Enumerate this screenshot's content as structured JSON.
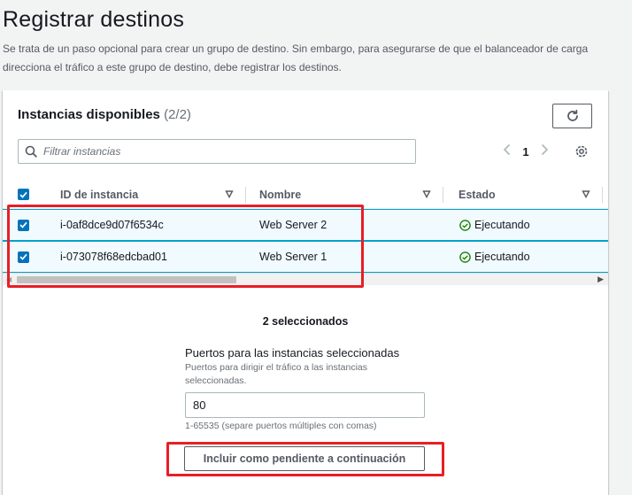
{
  "page": {
    "title": "Registrar destinos",
    "description": "Se trata de un paso opcional para crear un grupo de destino. Sin embargo, para asegurarse de que el balanceador de carga direcciona el tráfico a este grupo de destino, debe registrar los destinos."
  },
  "instances_panel": {
    "title": "Instancias disponibles",
    "count": "(2/2)",
    "filter_placeholder": "Filtrar instancias",
    "current_page": "1",
    "columns": [
      "ID de instancia",
      "Nombre",
      "Estado"
    ],
    "rows": [
      {
        "id": "i-0af8dce9d07f6534c",
        "name": "Web Server 2",
        "status": "Ejecutando",
        "selected": true
      },
      {
        "id": "i-073078f68edcbad01",
        "name": "Web Server 1",
        "status": "Ejecutando",
        "selected": true
      }
    ]
  },
  "selection": {
    "count_label": "2 seleccionados",
    "ports_label": "Puertos para las instancias seleccionadas",
    "ports_description": "Puertos para dirigir el tráfico a las instancias seleccionadas.",
    "ports_value": "80",
    "ports_hint": "1-65535 (separe puertos múltiples con comas)",
    "include_button": "Incluir como pendiente a continuación"
  },
  "colors": {
    "accent": "#0073bb",
    "success": "#1d8102",
    "highlight": "#e81e25",
    "selected_row_bg": "#f1faff"
  },
  "icons": [
    "refresh-icon",
    "search-icon",
    "chevron-left-icon",
    "chevron-right-icon",
    "settings-icon",
    "sort-icon",
    "check-circle-icon",
    "checkbox-checked-icon"
  ]
}
